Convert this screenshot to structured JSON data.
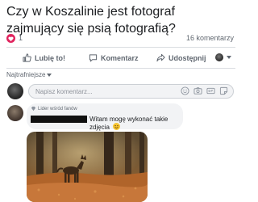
{
  "post": {
    "title": "Czy w Koszalinie jest fotograf zajmujący się psią fotografią?",
    "reaction_count": "1",
    "reaction_color": "#e0245e",
    "comment_count": "16 komentarzy"
  },
  "actions": {
    "like_label": "Lubię to!",
    "comment_label": "Komentarz",
    "share_label": "Udostępnij"
  },
  "sort": {
    "label": "Najtrafniejsze"
  },
  "composer": {
    "placeholder": "Napisz komentarz..."
  },
  "comment": {
    "badge": "Lider wśród fanów",
    "text": "Witam mogę wykonać takie zdjęcia",
    "emoji": "smile-emoji"
  },
  "icons": [
    "heart-icon",
    "thumbs-up-icon",
    "speech-bubble-icon",
    "share-arrow-icon",
    "chevron-down-icon",
    "emoji-icon",
    "camera-icon",
    "gif-icon",
    "sticker-icon",
    "diamond-icon"
  ],
  "colors": {
    "text": "#1c1e21",
    "secondary": "#606770",
    "input_bg": "#f2f3f5",
    "heart": "#e0245e"
  }
}
